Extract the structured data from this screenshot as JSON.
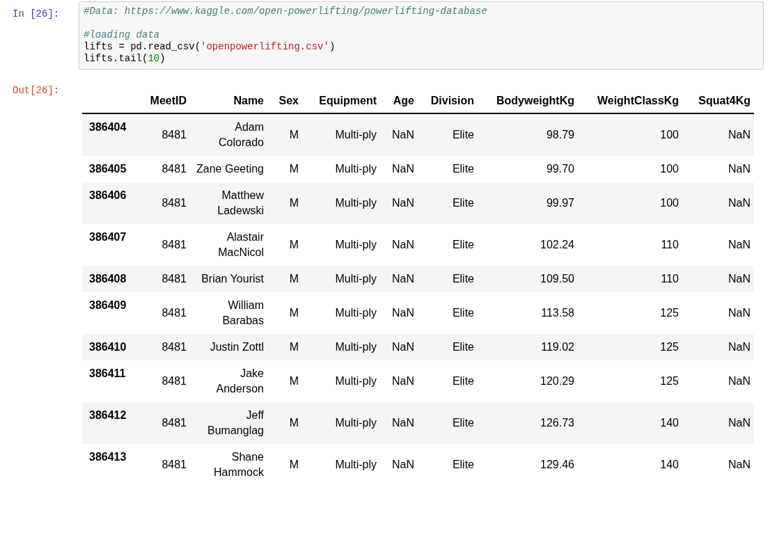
{
  "input_cell": {
    "prompt": "In [26]:",
    "code_blocks": [
      [
        [
          {
            "kind": "comment",
            "text": "#Data: https://www.kaggle.com/open-powerlifting/powerlifting-database"
          }
        ]
      ],
      [
        [
          {
            "kind": "comment",
            "text": "#loading data"
          }
        ],
        [
          {
            "kind": "plain",
            "text": "lifts = pd.read_csv("
          },
          {
            "kind": "string",
            "text": "'openpowerlifting.csv'"
          },
          {
            "kind": "plain",
            "text": ")"
          }
        ],
        [
          {
            "kind": "plain",
            "text": "lifts.tail("
          },
          {
            "kind": "number",
            "text": "10"
          },
          {
            "kind": "plain",
            "text": ")"
          }
        ]
      ]
    ]
  },
  "output_cell": {
    "prompt": "Out[26]:",
    "table": {
      "columns": [
        "MeetID",
        "Name",
        "Sex",
        "Equipment",
        "Age",
        "Division",
        "BodyweightKg",
        "WeightClassKg",
        "Squat4Kg"
      ],
      "rows": [
        {
          "index": "386404",
          "cells": [
            "8481",
            "Adam Colorado",
            "M",
            "Multi-ply",
            "NaN",
            "Elite",
            "98.79",
            "100",
            "NaN"
          ]
        },
        {
          "index": "386405",
          "cells": [
            "8481",
            "Zane Geeting",
            "M",
            "Multi-ply",
            "NaN",
            "Elite",
            "99.70",
            "100",
            "NaN"
          ]
        },
        {
          "index": "386406",
          "cells": [
            "8481",
            "Matthew Ladewski",
            "M",
            "Multi-ply",
            "NaN",
            "Elite",
            "99.97",
            "100",
            "NaN"
          ]
        },
        {
          "index": "386407",
          "cells": [
            "8481",
            "Alastair MacNicol",
            "M",
            "Multi-ply",
            "NaN",
            "Elite",
            "102.24",
            "110",
            "NaN"
          ]
        },
        {
          "index": "386408",
          "cells": [
            "8481",
            "Brian Yourist",
            "M",
            "Multi-ply",
            "NaN",
            "Elite",
            "109.50",
            "110",
            "NaN"
          ]
        },
        {
          "index": "386409",
          "cells": [
            "8481",
            "William Barabas",
            "M",
            "Multi-ply",
            "NaN",
            "Elite",
            "113.58",
            "125",
            "NaN"
          ]
        },
        {
          "index": "386410",
          "cells": [
            "8481",
            "Justin Zottl",
            "M",
            "Multi-ply",
            "NaN",
            "Elite",
            "119.02",
            "125",
            "NaN"
          ]
        },
        {
          "index": "386411",
          "cells": [
            "8481",
            "Jake Anderson",
            "M",
            "Multi-ply",
            "NaN",
            "Elite",
            "120.29",
            "125",
            "NaN"
          ]
        },
        {
          "index": "386412",
          "cells": [
            "8481",
            "Jeff Bumanglag",
            "M",
            "Multi-ply",
            "NaN",
            "Elite",
            "126.73",
            "140",
            "NaN"
          ]
        },
        {
          "index": "386413",
          "cells": [
            "8481",
            "Shane Hammock",
            "M",
            "Multi-ply",
            "NaN",
            "Elite",
            "129.46",
            "140",
            "NaN"
          ]
        }
      ]
    }
  }
}
